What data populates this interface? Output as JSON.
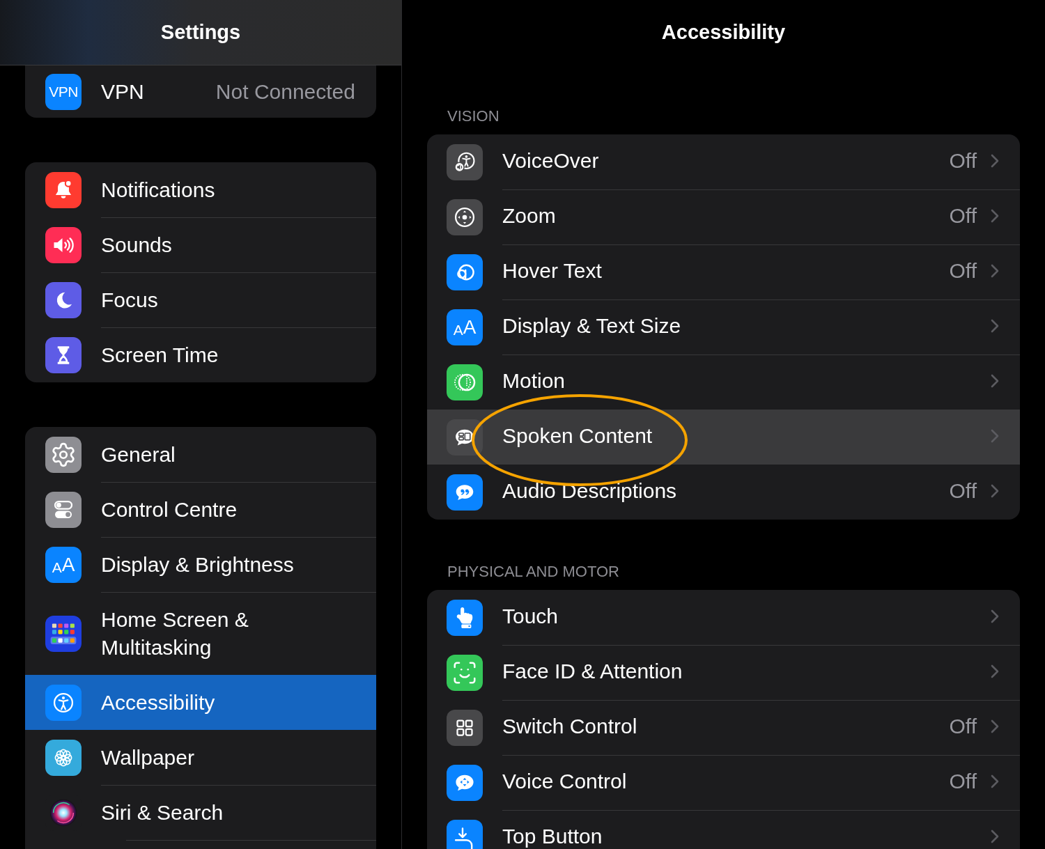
{
  "sidebar": {
    "title": "Settings",
    "groups": [
      {
        "items": [
          {
            "label": "VPN",
            "value": "Not Connected",
            "icon_text": "VPN",
            "selected": false
          }
        ]
      },
      {
        "items": [
          {
            "label": "Notifications",
            "selected": false
          },
          {
            "label": "Sounds",
            "selected": false
          },
          {
            "label": "Focus",
            "selected": false
          },
          {
            "label": "Screen Time",
            "selected": false
          }
        ]
      },
      {
        "items": [
          {
            "label": "General",
            "selected": false
          },
          {
            "label": "Control Centre",
            "selected": false
          },
          {
            "label": "Display & Brightness",
            "icon_text": "AA",
            "selected": false
          },
          {
            "label": "Home Screen & Multitasking",
            "selected": false
          },
          {
            "label": "Accessibility",
            "selected": true
          },
          {
            "label": "Wallpaper",
            "selected": false
          },
          {
            "label": "Siri & Search",
            "selected": false
          }
        ]
      }
    ]
  },
  "detail": {
    "title": "Accessibility",
    "sections": [
      {
        "header": "VISION",
        "items": [
          {
            "label": "VoiceOver",
            "value": "Off",
            "selected": false,
            "circled": false
          },
          {
            "label": "Zoom",
            "value": "Off",
            "selected": false,
            "circled": false
          },
          {
            "label": "Hover Text",
            "value": "Off",
            "selected": false,
            "circled": false
          },
          {
            "label": "Display & Text Size",
            "icon_text": "AA",
            "selected": false,
            "circled": false
          },
          {
            "label": "Motion",
            "selected": false,
            "circled": false
          },
          {
            "label": "Spoken Content",
            "selected": true,
            "circled": true
          },
          {
            "label": "Audio Descriptions",
            "value": "Off",
            "selected": false,
            "circled": false
          }
        ]
      },
      {
        "header": "PHYSICAL AND MOTOR",
        "items": [
          {
            "label": "Touch",
            "selected": false,
            "circled": false
          },
          {
            "label": "Face ID & Attention",
            "selected": false,
            "circled": false
          },
          {
            "label": "Switch Control",
            "value": "Off",
            "selected": false,
            "circled": false
          },
          {
            "label": "Voice Control",
            "value": "Off",
            "selected": false,
            "circled": false
          },
          {
            "label": "Top Button",
            "selected": false,
            "circled": false
          }
        ]
      }
    ]
  }
}
